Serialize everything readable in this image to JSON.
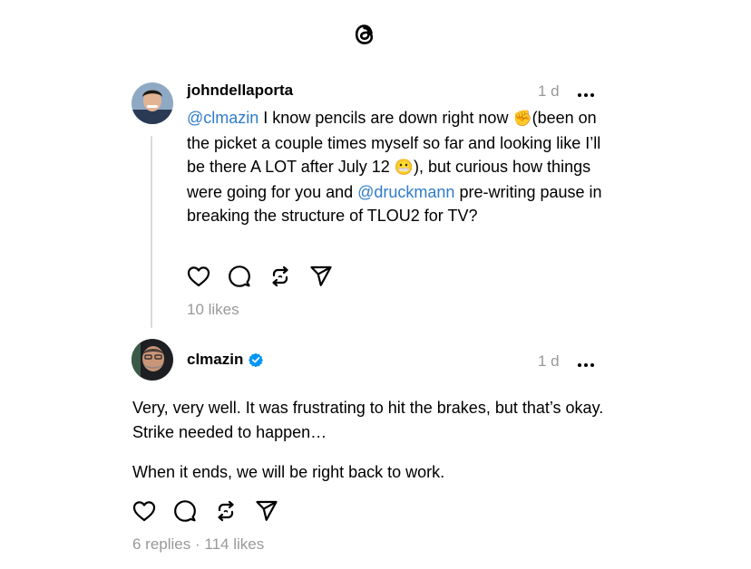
{
  "app": {
    "logo_icon": "threads-logo-icon"
  },
  "parent_post": {
    "username": "johndellaporta",
    "time": "1 d",
    "more_icon": "more-dots-icon",
    "text_parts": {
      "mention1": "@clmazin",
      "seg1": " I know pencils are down right now ",
      "emoji_fist": "✊",
      "seg2": "(been on the picket a couple times myself so far and looking like I’ll be there A LOT after July 12 ",
      "emoji_face": "😬",
      "seg3": "), but curious how things were going for you and ",
      "mention2": "@druckmann",
      "seg4": "  pre-writing pause in breaking the structure of TLOU2 for TV?"
    },
    "likes": "10 likes"
  },
  "reply_post": {
    "username": "clmazin",
    "verified_icon": "verified-badge-icon",
    "time": "1 d",
    "paragraph1": "Very, very well. It was frustrating to hit the brakes, but that’s okay. Strike needed to happen…",
    "paragraph2": "When it ends, we will be right back to work.",
    "replies": "6 replies",
    "separator": "·",
    "likes": "114 likes"
  },
  "actions": [
    "heart-icon",
    "comment-icon",
    "repost-icon",
    "share-icon"
  ],
  "colors": {
    "mention": "#2f7ccc",
    "muted": "#999999",
    "verified": "#0095f6",
    "thread_line": "#d9d9d9"
  }
}
